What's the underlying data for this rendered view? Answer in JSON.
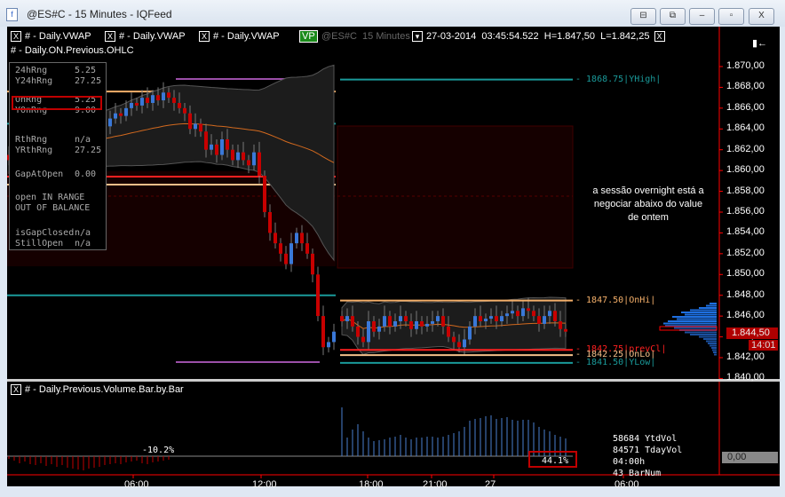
{
  "window": {
    "title": "@ES#C - 15 Minutes - IQFeed",
    "buttons": [
      "⊟",
      "⧉",
      "–",
      "▫",
      "X"
    ]
  },
  "header": {
    "indicators": [
      "# - Daily.VWAP",
      "# - Daily.VWAP",
      "# - Daily.VWAP"
    ],
    "vp_badge": "VP",
    "symbol": "@ES#C",
    "interval": "15 Minutes",
    "date": "27-03-2014",
    "time": "03:45:54.522",
    "high": "H=1.847,50",
    "low": "L=1.842,25",
    "ohlc_indicator": "# - Daily.ON.Previous.OHLC",
    "close_x": "X",
    "panel_icon": "▮←"
  },
  "info_box": [
    [
      "24hRng",
      "5.25"
    ],
    [
      "Y24hRng",
      "27.25"
    ],
    [
      "OnRng",
      "5.25"
    ],
    [
      "YOnRng",
      "9.00"
    ],
    [
      "RthRng",
      "n/a"
    ],
    [
      "YRthRng",
      "27.25"
    ],
    [
      "GapAtOpen",
      "0.00"
    ],
    [
      "open IN RANGE",
      ""
    ],
    [
      "OUT OF BALANCE",
      ""
    ],
    [
      "isGapClosed",
      "n/a"
    ],
    [
      "StillOpen",
      "n/a"
    ]
  ],
  "annotation": [
    "a sessão overnight está a",
    "negociar abaixo do value",
    "de ontem"
  ],
  "levels": [
    {
      "label": "- 1868.75|YHigh|",
      "price": 1868.75,
      "color": "#1a9a9a"
    },
    {
      "label": "- 1847.50|OnHi|",
      "price": 1847.5,
      "color": "#f5b06a"
    },
    {
      "label": "- 1842.75|prevCl|",
      "price": 1842.75,
      "color": "#ff2020"
    },
    {
      "label": "- 1842.25|OnLo|",
      "price": 1842.25,
      "color": "#f5c08a"
    },
    {
      "label": "- 1841.50|YLow|",
      "price": 1841.5,
      "color": "#1a9a9a"
    }
  ],
  "price_axis": [
    "1.870,00",
    "1.868,00",
    "1.866,00",
    "1.864,00",
    "1.862,00",
    "1.860,00",
    "1.858,00",
    "1.856,00",
    "1.854,00",
    "1.852,00",
    "1.850,00",
    "1.848,00",
    "1.846,00",
    "1.844,00",
    "1.842,00",
    "1.840,00"
  ],
  "last_price": "1.844,50",
  "countdown": "14:01",
  "volume_panel": {
    "title": "# - Daily.Previous.Volume.Bar.by.Bar",
    "prev_pct": "-10.2%",
    "cur_pct": "44.1%",
    "axis_value": "0,00",
    "stats": [
      "58684 YtdVol",
      "84571 TdayVol",
      "04:00h",
      "43 BarNum"
    ],
    "prev_values": [
      -3,
      -5,
      -8,
      -6,
      -9,
      -10,
      -8,
      -11,
      -9,
      -12,
      -10,
      -13,
      -14,
      -15,
      -16,
      -14,
      -13,
      -12,
      -10,
      -9,
      -8,
      -9,
      -7,
      -6,
      -5,
      -8,
      -9,
      -7,
      -6,
      -5,
      -4
    ],
    "cur_values": [
      55,
      21,
      30,
      36,
      28,
      21,
      17,
      18,
      19,
      21,
      22,
      24,
      21,
      19,
      21,
      21,
      22,
      22,
      21,
      22,
      24,
      26,
      28,
      33,
      40,
      42,
      43,
      45,
      46,
      42,
      43,
      44,
      41,
      40,
      41,
      41,
      38,
      33,
      30,
      28,
      24,
      22,
      20
    ]
  },
  "chart_data": {
    "type": "candlestick",
    "ylim": [
      1840,
      1871
    ],
    "session1_closes": [
      1861,
      1861.5,
      1862,
      1861.75,
      1862.5,
      1862,
      1863,
      1862.5,
      1863.25,
      1863,
      1863.5,
      1863.25,
      1864,
      1863.5,
      1864.25,
      1864,
      1864.5,
      1864.75,
      1864.25,
      1865,
      1865.5,
      1865.25,
      1866,
      1866.5,
      1866.25,
      1867,
      1866.5,
      1867.25,
      1866.75,
      1867.5,
      1867,
      1866.5,
      1866,
      1865.5,
      1864,
      1864.5,
      1863.75,
      1862,
      1862.5,
      1861.5,
      1863,
      1862,
      1861,
      1861.75,
      1861,
      1860.5,
      1861.75,
      1859.5,
      1856,
      1854,
      1853,
      1852,
      1851,
      1853,
      1854,
      1853,
      1852,
      1850,
      1846,
      1843,
      1843.5,
      1844.5
    ],
    "session2_closes": [
      1845.5,
      1846,
      1845,
      1844,
      1843.5,
      1845.5,
      1844.5,
      1845,
      1846,
      1845,
      1845.5,
      1846,
      1845.5,
      1844.75,
      1845.5,
      1845,
      1845.25,
      1845.5,
      1846,
      1845,
      1844,
      1843.5,
      1843,
      1843.75,
      1845,
      1846,
      1845.5,
      1845.75,
      1846,
      1845.5,
      1846,
      1846.25,
      1846.5,
      1846,
      1846.75,
      1846.5,
      1846,
      1845.25,
      1846,
      1846.5,
      1845.5,
      1844.75,
      1844.5
    ]
  },
  "time_axis": [
    {
      "label": "06:00"
    },
    {
      "label": "12:00"
    },
    {
      "label": "18:00"
    },
    {
      "label": "21:00"
    },
    {
      "label": "27"
    },
    {
      "label": "06:00"
    }
  ]
}
